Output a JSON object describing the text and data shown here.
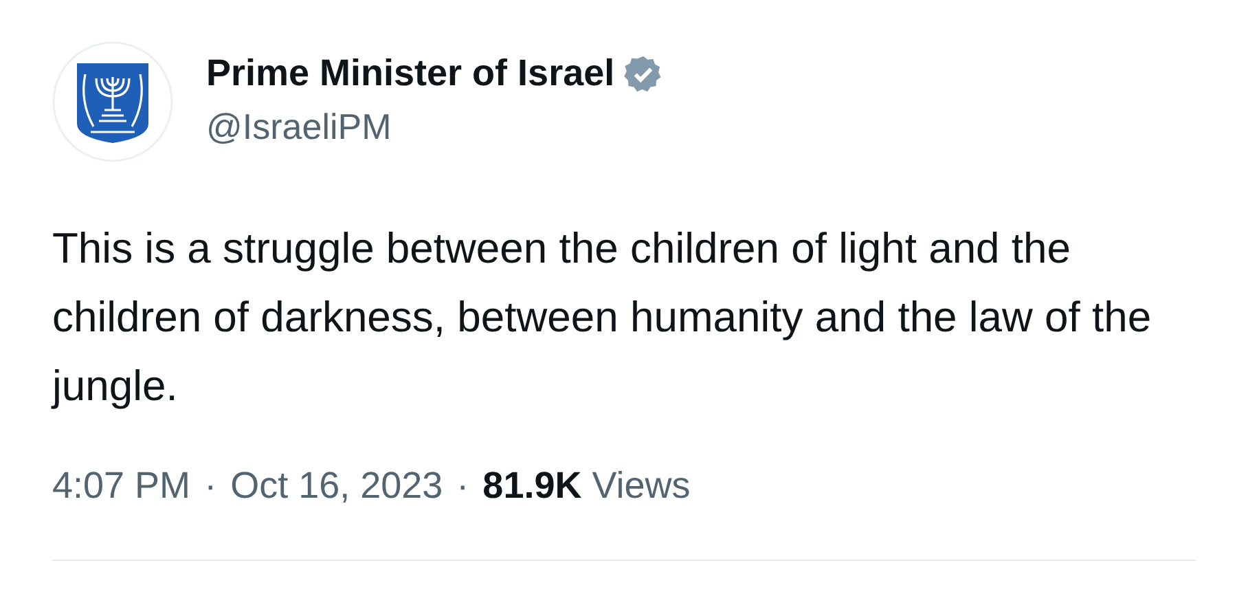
{
  "author": {
    "name": "Prime Minister of Israel",
    "verified": true,
    "handle": "@IsraeliPM"
  },
  "text": "This is a struggle between the children of light and the children of darkness, between humanity and the law of the jungle.",
  "meta": [
    "4:07 PM",
    "·",
    "Oct 16, 2023",
    "·",
    "**81.9K** Views"
  ]
}
